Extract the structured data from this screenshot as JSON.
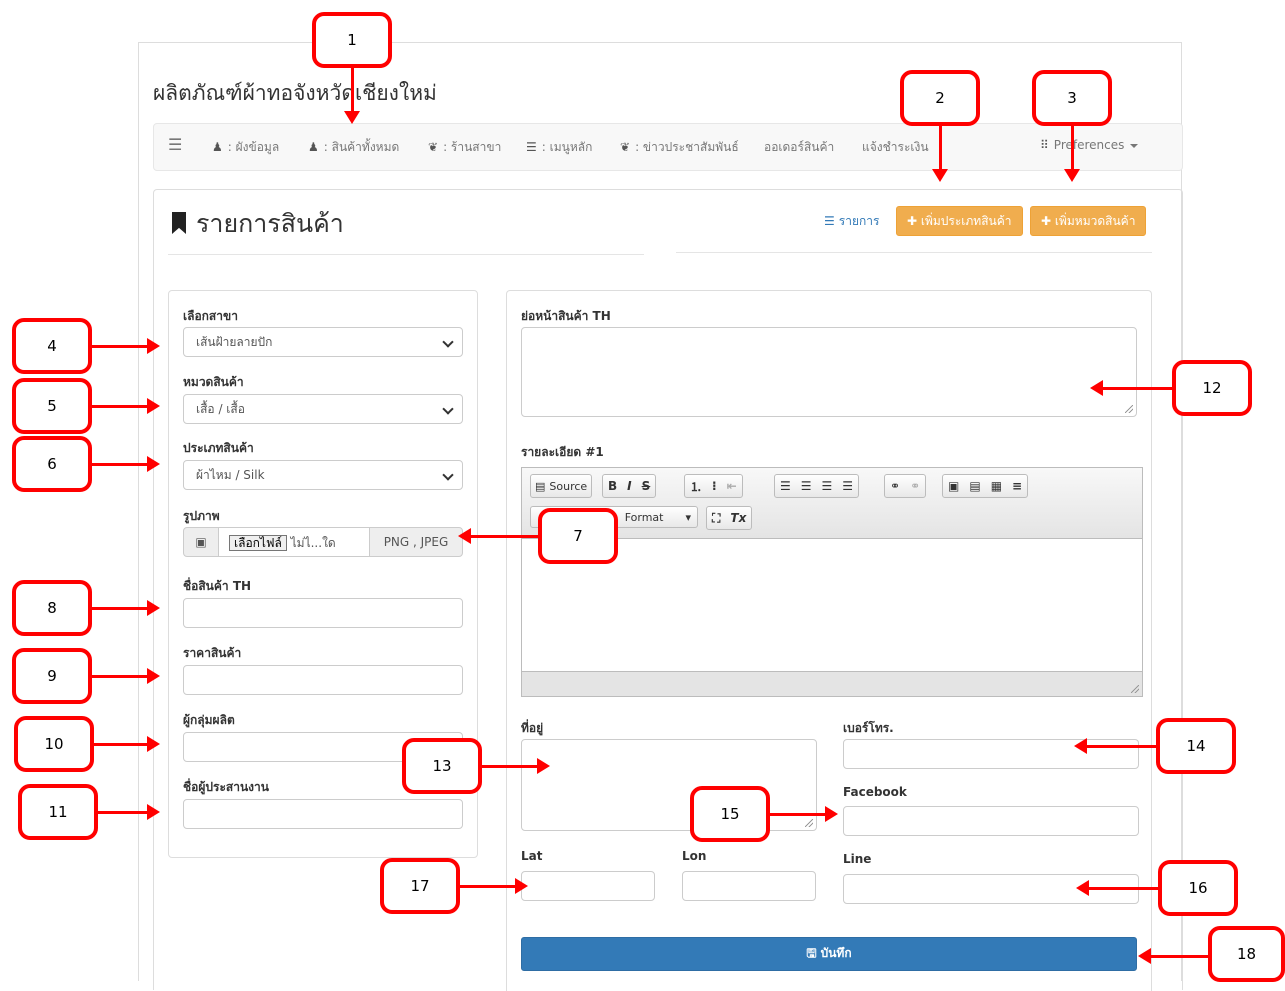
{
  "site": {
    "title": "ผลิตภัณฑ์ผ้าทอจังหวัดเชียงใหม่"
  },
  "nav": {
    "items": [
      {
        "icon": "☰",
        "label": ""
      },
      {
        "icon": "♟",
        "label": ": ผังข้อมูล"
      },
      {
        "icon": "♟",
        "label": ": สินค้าทั้งหมด"
      },
      {
        "icon": "❦",
        "label": ": ร้านสาขา"
      },
      {
        "icon": "☰",
        "label": ": เมนูหลัก"
      },
      {
        "icon": "❦",
        "label": ": ข่าวประชาสัมพันธ์"
      },
      {
        "icon": "",
        "label": "ออเดอร์สินค้า"
      },
      {
        "icon": "",
        "label": "แจ้งชำระเงิน"
      }
    ],
    "preferences_icon": "⠿",
    "preferences": "Preferences"
  },
  "page": {
    "heading": "รายการสินค้า",
    "list_icon": "☰",
    "list_link": "รายการ",
    "add_type_button": "✚ เพิ่มประเภทสินค้า",
    "add_category_button": "✚ เพิ่มหมวดสินค้า"
  },
  "form": {
    "branch_label": "เลือกสาขา",
    "branch_value": "เส้นฝ้ายลายปัก",
    "category_label": "หมวดสินค้า",
    "category_value": "เสื้อ / เสื้อ",
    "type_label": "ประเภทสินค้า",
    "type_value": "ผ้าไหม / Silk",
    "image_label": "รูปภาพ",
    "image_icon": "▣",
    "choose_file": "เลือกไฟล์",
    "no_file": "ไม่ไ...ใด",
    "image_formats": "PNG , JPEG",
    "name_label": "ชื่อสินค้า TH",
    "price_label": "ราคาสินค้า",
    "producer_label": "ผู้กลุ่มผลิต",
    "coordinator_label": "ชื่อผู้ประสานงาน",
    "summary_label": "ย่อหน้าสินค้า TH",
    "detail_label": "รายละเอียด #1",
    "address_label": "ที่อยู่",
    "phone_label": "เบอร์โทร.",
    "facebook_label": "Facebook",
    "lat_label": "Lat",
    "lon_label": "Lon",
    "line_label": "Line",
    "save_icon": "🖫",
    "save_button": "บันทึก"
  },
  "editor": {
    "source": "Source",
    "bold": "B",
    "italic": "I",
    "strike": "S",
    "format": "Format",
    "maximize": "⛶",
    "remove_format": "Tx"
  },
  "callouts": [
    "1",
    "2",
    "3",
    "4",
    "5",
    "6",
    "7",
    "8",
    "9",
    "10",
    "11",
    "12",
    "13",
    "14",
    "15",
    "16",
    "17",
    "18"
  ],
  "colors": {
    "annotation": "#ff0000",
    "warning": "#f0ad4e",
    "primary": "#337ab7"
  }
}
